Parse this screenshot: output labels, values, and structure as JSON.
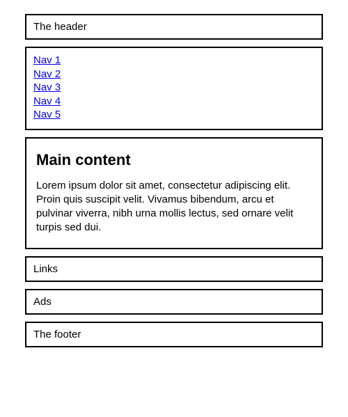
{
  "header": {
    "text": "The header"
  },
  "nav": {
    "items": [
      {
        "label": "Nav 1"
      },
      {
        "label": "Nav 2"
      },
      {
        "label": "Nav 3"
      },
      {
        "label": "Nav 4"
      },
      {
        "label": "Nav 5"
      }
    ]
  },
  "main": {
    "heading": "Main content",
    "body": "Lorem ipsum dolor sit amet, consectetur adipiscing elit. Proin quis suscipit velit. Vivamus bibendum, arcu et pulvinar viverra, nibh urna mollis lectus, sed ornare velit turpis sed dui."
  },
  "aside": {
    "links_label": "Links",
    "ads_label": "Ads"
  },
  "footer": {
    "text": "The footer"
  }
}
